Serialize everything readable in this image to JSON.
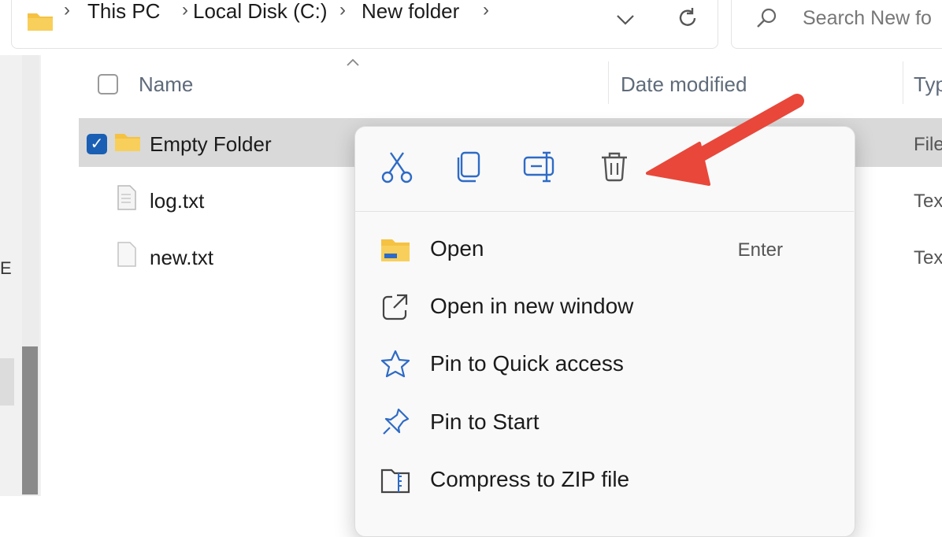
{
  "address_bar": {
    "breadcrumbs": [
      "This PC",
      "Local Disk (C:)",
      "New folder"
    ],
    "search_placeholder": "Search New fo"
  },
  "nav_pane": {
    "partial_label": "Ex"
  },
  "columns": {
    "name": "Name",
    "date_modified": "Date modified",
    "type": "Typ"
  },
  "files": [
    {
      "name": "Empty Folder",
      "type": "File",
      "selected": true,
      "icon": "folder-icon"
    },
    {
      "name": "log.txt",
      "type": "Tex",
      "selected": false,
      "icon": "text-file-icon"
    },
    {
      "name": "new.txt",
      "type": "Tex",
      "selected": false,
      "icon": "text-file-icon"
    }
  ],
  "context_menu": {
    "quick_actions": [
      "cut-icon",
      "copy-icon",
      "rename-icon",
      "delete-icon"
    ],
    "items": [
      {
        "label": "Open",
        "shortcut": "Enter",
        "icon": "folder-open-icon"
      },
      {
        "label": "Open in new window",
        "icon": "open-new-window-icon"
      },
      {
        "label": "Pin to Quick access",
        "icon": "star-icon"
      },
      {
        "label": "Pin to Start",
        "icon": "pin-icon"
      },
      {
        "label": "Compress to ZIP file",
        "icon": "zip-icon"
      }
    ]
  },
  "colors": {
    "accent": "#1a5fb4",
    "folder": "#f5c242",
    "arrow": "#e8473a",
    "selected_row": "#d9d9d9"
  }
}
